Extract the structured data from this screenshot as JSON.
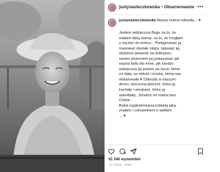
{
  "header": {
    "username": "justynasteczkowska",
    "separator": "•",
    "follow_label": "Obserwowanie",
    "more_label": "•••"
  },
  "caption": {
    "username": "justynasteczkowska",
    "first_text": "Nasza mama odeszła...",
    "heart": "♥",
    "lines": [
      "Jestem wdzięczna Bogu za to, że",
      "miałam taką mamę, za to, że mogłam",
      "z nią być do końca... Pielęgnować ją,",
      "masować obolałe stopy, śpiewać jej",
      "ulubione piosenki na dobranoc,",
      "swoim służeniem jej pokazywać jak",
      "ważna była dla mnie, jak bardzo",
      "wdzięczna jej jestem za życie, które",
      "mi dała, za miłość i troskę, którą nas",
      "obdarowała",
      "domu, otoczona dziećmi, które ją",
      "kochały i wnukami, które ją",
      "uwielbiały...Smutno mi mama bez",
      "Ciebie...",
      "Byłaś najdzielniejszą kobietą jaką",
      "znałam i człowiekiem o wielkim"
    ],
    "line10_tail": "Odeszła w naszym",
    "last_fragment": "..."
  },
  "footer": {
    "views": "61 546 wyświetleń",
    "date": "14 GODZ. TEMU"
  },
  "icons": {
    "like": "heart-icon",
    "comment": "comment-icon",
    "share": "share-icon",
    "save": "bookmark-icon"
  },
  "colors": {
    "heart": "#c8102e",
    "ring": "#e1306c"
  }
}
